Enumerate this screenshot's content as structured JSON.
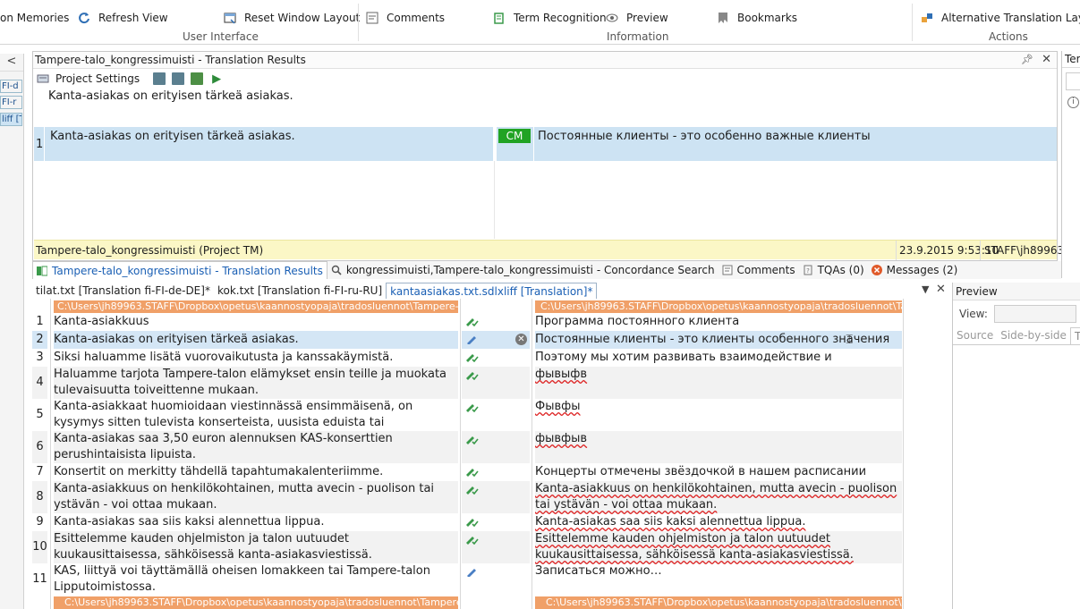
{
  "ribbon": {
    "items": [
      {
        "label": "on Memories"
      },
      {
        "label": "Refresh View"
      },
      {
        "label": "Reset Window Layout"
      },
      {
        "label": "Comments"
      },
      {
        "label": "Term Recognition"
      },
      {
        "label": "Preview"
      },
      {
        "label": "Bookmarks"
      },
      {
        "label": "Alternative Translation Layout"
      }
    ],
    "groups": [
      "User Interface",
      "Information",
      "Actions"
    ]
  },
  "left_strip": {
    "collapse": "<",
    "items": [
      "FI-d",
      "FI-r",
      "liff [T"
    ]
  },
  "results_panel": {
    "title": "Tampere-talo_kongressimuisti - Translation Results",
    "project_settings": "Project Settings",
    "source_text": "Kanta-asiakas on erityisen tärkeä asiakas.",
    "match": {
      "index": "1",
      "source": "Kanta-asiakas on erityisen tärkeä asiakas.",
      "badge": "CM",
      "target": "Постоянные клиенты - это особенно важные клиенты"
    },
    "footer": {
      "tm": "Tampere-talo_kongressimuisti (Project TM)",
      "date": "23.9.2015 9:53:10",
      "user": "STAFF\\jh89963"
    }
  },
  "right_panel": {
    "title": "Ter"
  },
  "bottom_tabs": [
    {
      "label": "Tampere-talo_kongressimuisti - Translation Results"
    },
    {
      "label": "kongressimuisti,Tampere-talo_kongressimuisti - Concordance Search"
    },
    {
      "label": "Comments"
    },
    {
      "label": "TQAs (0)"
    },
    {
      "label": "Messages (2)"
    }
  ],
  "doc_tabs": [
    {
      "label": "tilat.txt [Translation fi-FI-de-DE]*"
    },
    {
      "label": "kok.txt [Translation fi-FI-ru-RU]"
    },
    {
      "label": "kantaasiakas.txt.sdlxliff [Translation]*"
    }
  ],
  "editor": {
    "path_top_src": "C:\\Users\\jh89963.STAFF\\Dropbox\\opetus\\kaannostyopaja\\tradosluennot\\Tampere-talo\\fi-FI\\",
    "path_top_tgt": "C:\\Users\\jh89963.STAFF\\Dropbox\\opetus\\kaannostyopaja\\tradosluennot\\Tampere-t",
    "path_bottom_src": "C:\\Users\\jh89963.STAFF\\Dropbox\\opetus\\kaannostyopaja\\tradosluennot\\Tampere-talo\\fi-FI",
    "path_bottom_tgt": "C:\\Users\\jh89963.STAFF\\Dropbox\\opetus\\kaannostyopaja\\tradosluennot\\Tampere-ta",
    "rows": [
      {
        "num": "1",
        "src": "Kanta-asiakkuus",
        "tgt": "Программа постоянного клиента",
        "status": "confirmed"
      },
      {
        "num": "2",
        "src": "Kanta-asiakas on erityisen tärkeä asiakas.",
        "tgt": "Постоянные клиенты - это клиенты особенного значения",
        "status": "draft"
      },
      {
        "num": "3",
        "src": "Siksi haluamme lisätä vuorovaikutusta ja kanssakäymistä.",
        "tgt": "Поэтому мы хотим развивать взаимодействие и сотрудничество",
        "status": "confirmed"
      },
      {
        "num": "4",
        "src": "Haluamme tarjota Tampere-talon elämykset ensin teille ja muokata tulevaisuutta toiveittenne mukaan.",
        "tgt": "фывыфв",
        "status": "confirmed"
      },
      {
        "num": "5",
        "src": "Kanta-asiakkaat huomioidaan viestinnässä ensimmäisenä, on kysymys sitten tulevista konserteista, uusista eduista tai asiakasinformaatiosta.",
        "tgt": "Фывфы",
        "status": "confirmed"
      },
      {
        "num": "6",
        "src": "Kanta-asiakas saa 3,50 euron alennuksen KAS-konserttien perushintaisista lipuista.",
        "tgt": "фывфыв",
        "status": "confirmed"
      },
      {
        "num": "7",
        "src": "Konsertit on merkitty tähdellä tapahtumakalenteriimme.",
        "tgt": "Концерты отмечены звёздочкой в нашем расписании",
        "status": "confirmed"
      },
      {
        "num": "8",
        "src": "Kanta-asiakkuus on henkilökohtainen, mutta avecin - puolison tai ystävän - voi ottaa mukaan.",
        "tgt": "Kanta-asiakkuus on henkilökohtainen, mutta avecin - puolison tai ystävän - voi ottaa mukaan.",
        "status": "confirmed"
      },
      {
        "num": "9",
        "src": "Kanta-asiakas saa siis kaksi alennettua lippua.",
        "tgt": "Kanta-asiakas saa siis kaksi alennettua lippua.",
        "status": "confirmed"
      },
      {
        "num": "10",
        "src": "Esittelemme kauden ohjelmiston ja talon uutuudet kuukausittaisessa, sähköisessä kanta-asiakasviestissä.",
        "tgt": "Esittelemme kauden ohjelmiston ja talon uutuudet kuukausittaisessa, sähköisessä kanta-asiakasviestissä.",
        "status": "confirmed"
      },
      {
        "num": "11",
        "src": "KAS, liittyä voi täyttämällä oheisen lomakkeen tai Tampere-talon Lipputoimistossa.",
        "tgt": "Записаться можно…",
        "status": "draft"
      }
    ]
  },
  "preview": {
    "title": "Preview",
    "view_label": "View:",
    "tabs": [
      "Source",
      "Side-by-side",
      "Ta"
    ]
  },
  "colors": {
    "selection": "#cde3f3",
    "cm_badge": "#21a324",
    "path_bar": "#f0a068",
    "tm_footer": "#fbf7c6"
  }
}
